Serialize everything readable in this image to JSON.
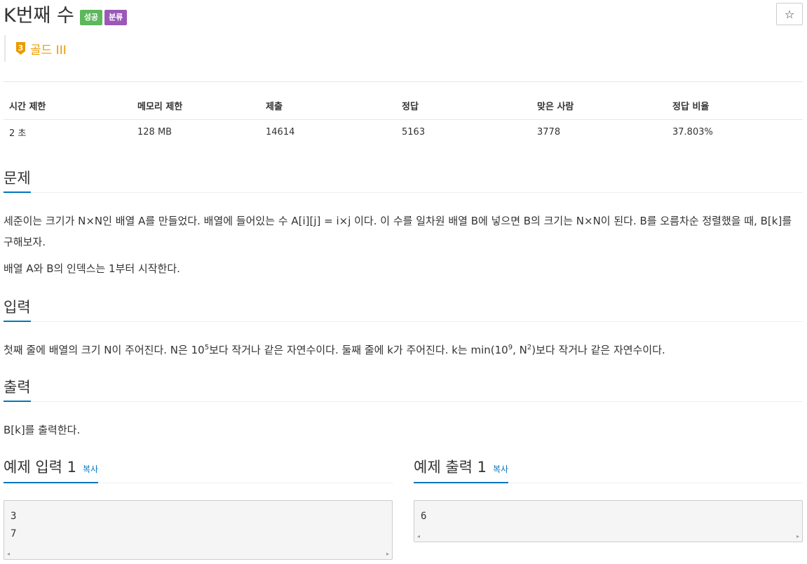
{
  "problem": {
    "title": "K번째 수",
    "badges": [
      {
        "label": "성공",
        "color": "#5cb85c"
      },
      {
        "label": "분류",
        "color": "#9b59b6"
      }
    ],
    "star_icon": "☆",
    "tier": {
      "number": "3",
      "label": "골드 III",
      "color": "#ec9a00"
    }
  },
  "info": {
    "headers": [
      "시간 제한",
      "메모리 제한",
      "제출",
      "정답",
      "맞은 사람",
      "정답 비율"
    ],
    "values": [
      "2 초",
      "128 MB",
      "14614",
      "5163",
      "3778",
      "37.803%"
    ]
  },
  "sections": {
    "description": {
      "heading": "문제",
      "p1": "세준이는 크기가 N×N인 배열 A를 만들었다. 배열에 들어있는 수 A[i][j] = i×j 이다. 이 수를 일차원 배열 B에 넣으면 B의 크기는 N×N이 된다. B를 오름차순 정렬했을 때, B[k]를 구해보자.",
      "p2": "배열 A와 B의 인덱스는 1부터 시작한다."
    },
    "input": {
      "heading": "입력",
      "t1": "첫째 줄에 배열의 크기 N이 주어진다. N은 10",
      "s1": "5",
      "t2": "보다 작거나 같은 자연수이다. 둘째 줄에 k가 주어진다. k는 min(10",
      "s2": "9",
      "t3": ", N",
      "s3": "2",
      "t4": ")보다 작거나 같은 자연수이다."
    },
    "output": {
      "heading": "출력",
      "text": "B[k]를 출력한다."
    }
  },
  "samples": {
    "input": {
      "heading": "예제 입력 1",
      "copy": "복사",
      "content": "3\n7"
    },
    "output": {
      "heading": "예제 출력 1",
      "copy": "복사",
      "content": "6"
    },
    "scroll_left": "◂",
    "scroll_right": "▸"
  },
  "colors": {
    "accent": "#0076c0",
    "success": "#5cb85c",
    "purple": "#9b59b6",
    "gold": "#ec9a00"
  }
}
